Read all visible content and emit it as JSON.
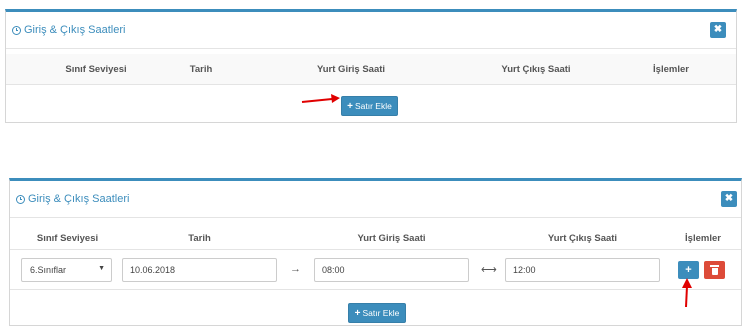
{
  "panel_top": {
    "title": "Giriş & Çıkış Saatleri",
    "close_label": "✖",
    "columns": [
      "Sınıf Seviyesi",
      "Tarih",
      "Yurt Giriş Saati",
      "Yurt Çıkış Saati",
      "İşlemler"
    ],
    "add_button": {
      "icon": "+",
      "label": "Satır Ekle"
    }
  },
  "panel_bottom": {
    "title": "Giriş & Çıkış Saatleri",
    "close_label": "✖",
    "columns": [
      "Sınıf Seviyesi",
      "Tarih",
      "Yurt Giriş Saati",
      "Yurt Çıkış Saati",
      "İşlemler"
    ],
    "row": {
      "class_level": "6.Sınıflar",
      "date": "10.06.2018",
      "arrow_one": "→",
      "entry_time": "08:00",
      "arrow_two": "⟷",
      "exit_time": "12:00",
      "add_icon": "+"
    },
    "add_button": {
      "icon": "+",
      "label": "Satır Ekle"
    }
  },
  "colors": {
    "primary": "#3c8dbc",
    "danger": "#dd4b39",
    "annotation": "#e00000"
  }
}
